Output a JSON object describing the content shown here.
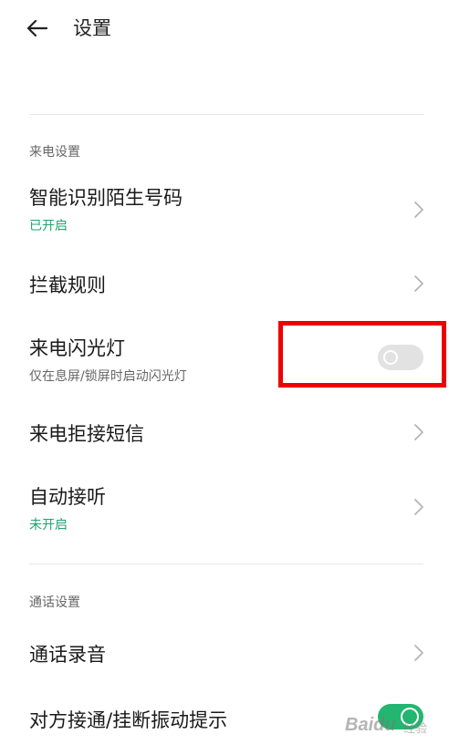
{
  "header": {
    "title": "设置",
    "back_icon": "arrow-left-icon"
  },
  "sections": {
    "incoming": {
      "label": "来电设置"
    },
    "call": {
      "label": "通话设置"
    }
  },
  "rows": {
    "smart_identify": {
      "title": "智能识别陌生号码",
      "status": "已开启"
    },
    "block_rules": {
      "title": "拦截规则"
    },
    "flash": {
      "title": "来电闪光灯",
      "desc": "仅在息屏/锁屏时启动闪光灯",
      "toggle_on": false
    },
    "reject_sms": {
      "title": "来电拒接短信"
    },
    "auto_answer": {
      "title": "自动接听",
      "status": "未开启"
    },
    "call_recording": {
      "title": "通话录音"
    },
    "vibrate": {
      "title": "对方接通/挂断振动提示",
      "toggle_on": true
    }
  },
  "watermark": {
    "text": "Baidu",
    "sub": "经验"
  },
  "colors": {
    "accent_green": "#22a36e",
    "toggle_on": "#22b670",
    "toggle_off": "#e2e2e2",
    "highlight_red": "#ee0000"
  }
}
